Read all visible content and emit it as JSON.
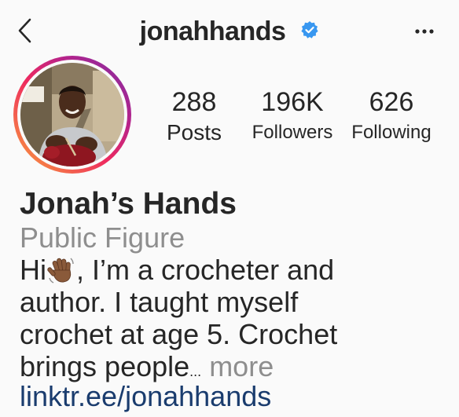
{
  "header": {
    "back_icon": "chevron-left-icon",
    "username": "jonahhands",
    "verified_icon": "verified-badge-icon",
    "more_icon": "more-horizontal-icon"
  },
  "profile": {
    "avatar_ring_colors": [
      "#f9a53a",
      "#ee2a5f",
      "#b8238a",
      "#7a2fa6"
    ]
  },
  "stats": {
    "posts": {
      "value": "288",
      "label": "Posts"
    },
    "followers": {
      "value": "196K",
      "label": "Followers"
    },
    "following": {
      "value": "626",
      "label": "Following"
    }
  },
  "bio": {
    "display_name": "Jonah’s Hands",
    "category": "Public Figure",
    "line1_start": "Hi",
    "line1_emoji": "waving-hand-emoji",
    "line1_end": ", I’m a crocheter and",
    "line2": "author. I taught myself",
    "line3": "crochet at age 5. Crochet",
    "line4": "brings people",
    "ellipsis": "...",
    "more": " more",
    "link": "linktr.ee/jonahhands"
  },
  "colors": {
    "text": "#262626",
    "secondary": "#8e8e8e",
    "link": "#1a3c6e",
    "verified": "#3897f0",
    "background": "#fafafa"
  }
}
